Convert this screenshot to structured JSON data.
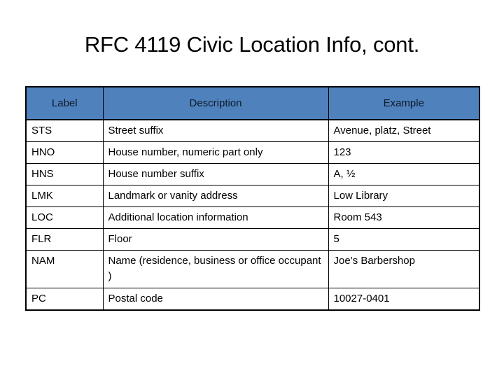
{
  "slide": {
    "title": "RFC 4119 Civic Location Info, cont.",
    "accent_color": "#4f81bd",
    "header_text_color": "#0d1b2a",
    "border_color": "#000000",
    "background_color": "#ffffff"
  },
  "table": {
    "columns": [
      "Label",
      "Description",
      "Example"
    ],
    "rows": [
      {
        "label": "STS",
        "description": "Street suffix",
        "example": "Avenue, platz, Street"
      },
      {
        "label": "HNO",
        "description": "House number, numeric part only",
        "example": "123"
      },
      {
        "label": "HNS",
        "description": "House number suffix",
        "example": "A, ½"
      },
      {
        "label": "LMK",
        "description": "Landmark or vanity address",
        "example": "Low Library"
      },
      {
        "label": "LOC",
        "description": "Additional location information",
        "example": "Room 543"
      },
      {
        "label": "FLR",
        "description": "Floor",
        "example": "5"
      },
      {
        "label": "NAM",
        "description": "Name (residence, business or office occupant )",
        "example": "Joe’s Barbershop"
      },
      {
        "label": "PC",
        "description": "Postal code",
        "example": "10027-0401"
      }
    ]
  }
}
